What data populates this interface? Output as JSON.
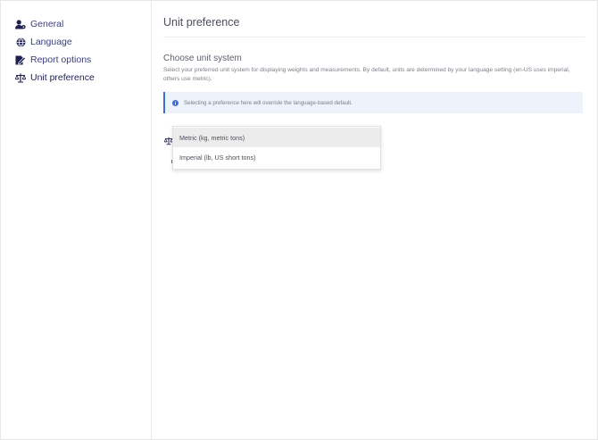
{
  "sidebar": {
    "items": [
      {
        "label": "General",
        "icon": "user-gear-icon"
      },
      {
        "label": "Language",
        "icon": "globe-icon"
      },
      {
        "label": "Report options",
        "icon": "report-edit-icon"
      },
      {
        "label": "Unit preference",
        "icon": "scale-icon",
        "active": true
      }
    ]
  },
  "main": {
    "title": "Unit preference",
    "section": {
      "title": "Choose unit system",
      "description": "Select your preferred unit system for displaying weights and measurements. By default, units are determined by your language setting (en-US uses imperial, others use metric)."
    },
    "info": {
      "icon": "info-icon",
      "text": "Selecting a preference here will override the language-based default."
    },
    "unit_select": {
      "icon": "scale-icon",
      "options": [
        {
          "label": "Metric (kg, metric tons)",
          "highlighted": true
        },
        {
          "label": "Imperial (lb, US short tons)",
          "highlighted": false
        }
      ]
    }
  },
  "colors": {
    "accent": "#3b6fd6",
    "nav_text": "#3a3f7a",
    "info_bg": "#eef2fb",
    "option_highlight": "#ececec"
  }
}
